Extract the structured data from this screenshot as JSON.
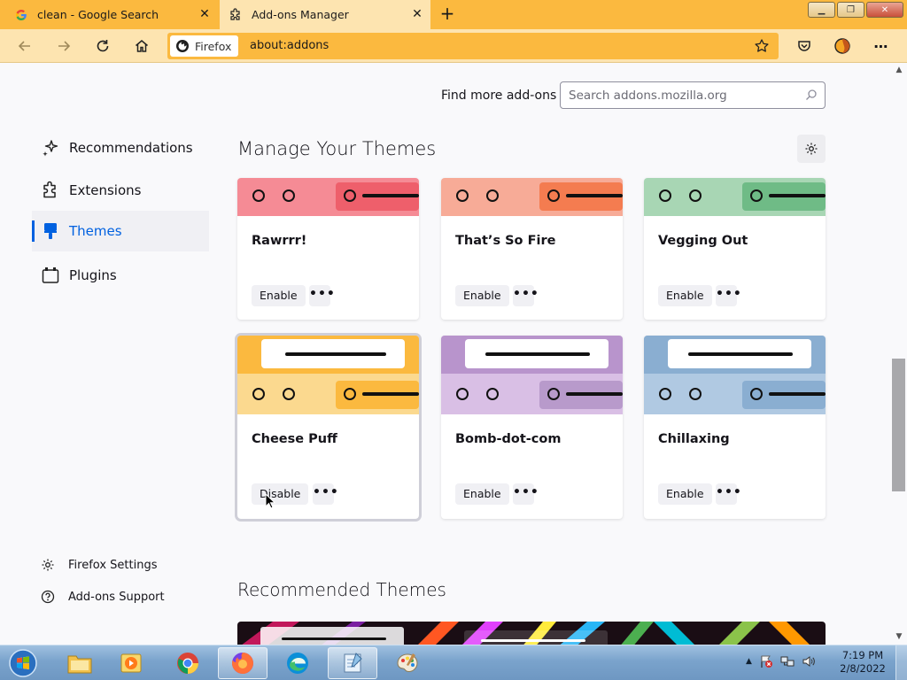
{
  "browser": {
    "tabs": [
      {
        "title": "clean - Google Search",
        "favicon": "google-icon",
        "active": false
      },
      {
        "title": "Add-ons Manager",
        "favicon": "puzzle-icon",
        "active": true
      }
    ],
    "identity_label": "Firefox",
    "url": "about:addons",
    "theme_color": "#fbb93f",
    "theme_light": "#fde4b0"
  },
  "page": {
    "find_more_label": "Find more add-ons",
    "search_placeholder": "Search addons.mozilla.org",
    "heading": "Manage Your Themes",
    "recommended_heading": "Recommended Themes",
    "accent_color": "#0061e0"
  },
  "sidebar": {
    "items": [
      {
        "label": "Recommendations",
        "icon": "sparkle-icon",
        "selected": false
      },
      {
        "label": "Extensions",
        "icon": "puzzle-icon",
        "selected": false
      },
      {
        "label": "Themes",
        "icon": "brush-icon",
        "selected": true
      },
      {
        "label": "Plugins",
        "icon": "plugin-icon",
        "selected": false
      }
    ],
    "footer": [
      {
        "label": "Firefox Settings",
        "icon": "gear-icon"
      },
      {
        "label": "Add-ons Support",
        "icon": "help-icon"
      }
    ]
  },
  "themes": [
    {
      "name": "Rawrrr!",
      "action": "Enable",
      "active": false,
      "colors": {
        "frame": "#f58b95",
        "tab": "#ee5f6b"
      }
    },
    {
      "name": "That’s So Fire",
      "action": "Enable",
      "active": false,
      "colors": {
        "frame": "#f7ab97",
        "tab": "#f47c50"
      }
    },
    {
      "name": "Vegging Out",
      "action": "Enable",
      "active": false,
      "colors": {
        "frame": "#a8d6b4",
        "tab": "#6fbb86"
      }
    },
    {
      "name": "Cheese Puff",
      "action": "Disable",
      "active": true,
      "colors": {
        "frame": "#fbd98f",
        "tab": "#fbb93f",
        "top": "#fbb93f"
      }
    },
    {
      "name": "Bomb-dot-com",
      "action": "Enable",
      "active": false,
      "colors": {
        "frame": "#d9bfe5",
        "tab": "#b89acb",
        "top": "#b894cc"
      }
    },
    {
      "name": "Chillaxing",
      "action": "Enable",
      "active": false,
      "colors": {
        "frame": "#b0c9e2",
        "tab": "#8aaed1",
        "top": "#8aaed1"
      }
    }
  ],
  "more_label": "•••",
  "taskbar": {
    "time": "7:19 PM",
    "date": "2/8/2022"
  }
}
